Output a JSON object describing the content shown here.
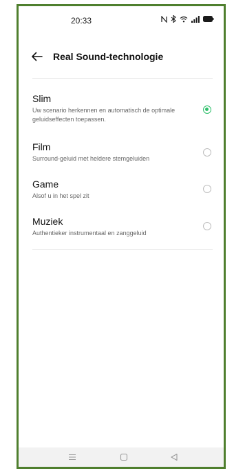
{
  "status_bar": {
    "time": "20:33",
    "icons": [
      "nfc-icon",
      "bluetooth-icon",
      "wifi-icon",
      "signal-icon",
      "battery-icon"
    ]
  },
  "header": {
    "title": "Real Sound-technologie",
    "back_icon": "arrow-left-icon"
  },
  "options": [
    {
      "title": "Slim",
      "description": "Uw scenario herkennen en automatisch de optimale geluidseffecten toepassen.",
      "selected": true
    },
    {
      "title": "Film",
      "description": "Surround-geluid met heldere stemgeluiden",
      "selected": false
    },
    {
      "title": "Game",
      "description": "Alsof u in het spel zit",
      "selected": false
    },
    {
      "title": "Muziek",
      "description": "Authentieker instrumentaal en zanggeluid",
      "selected": false
    }
  ],
  "nav_bar": {
    "buttons": [
      "menu-icon",
      "home-icon",
      "back-triangle-icon"
    ]
  },
  "colors": {
    "accent": "#2fbf6b",
    "frame": "#4f7f2e",
    "nav_bg": "#f2f2f2"
  }
}
